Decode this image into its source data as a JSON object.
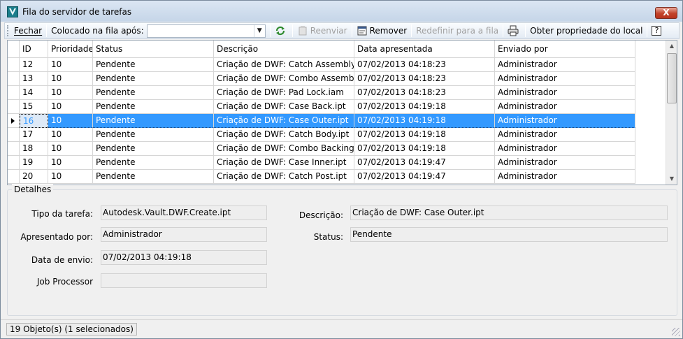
{
  "window": {
    "title": "Fila do servidor de tarefas",
    "close_label": "X"
  },
  "toolbar": {
    "close_label": "Fechar",
    "queued_after_label": "Colocado na fila após:",
    "queued_after_value": "",
    "resubmit_label": "Reenviar",
    "remove_label": "Remover",
    "reset_label": "Redefinir para a fila",
    "get_location_property_label": "Obter propriedade do local",
    "help_label": "?"
  },
  "grid": {
    "columns": [
      "ID",
      "Prioridade",
      "Status",
      "Descrição",
      "Data apresentada",
      "Enviado por"
    ],
    "rows": [
      {
        "id": "12",
        "priority": "10",
        "status": "Pendente",
        "description": "Criação de DWF: Catch Assembly.i...",
        "date": "07/02/2013 04:18:23",
        "sender": "Administrador"
      },
      {
        "id": "13",
        "priority": "10",
        "status": "Pendente",
        "description": "Criação de DWF: Combo Assembly...",
        "date": "07/02/2013 04:18:23",
        "sender": "Administrador"
      },
      {
        "id": "14",
        "priority": "10",
        "status": "Pendente",
        "description": "Criação de DWF: Pad Lock.iam",
        "date": "07/02/2013 04:18:23",
        "sender": "Administrador"
      },
      {
        "id": "15",
        "priority": "10",
        "status": "Pendente",
        "description": "Criação de DWF: Case Back.ipt",
        "date": "07/02/2013 04:19:18",
        "sender": "Administrador"
      },
      {
        "id": "16",
        "priority": "10",
        "status": "Pendente",
        "description": "Criação de DWF: Case Outer.ipt",
        "date": "07/02/2013 04:19:18",
        "sender": "Administrador"
      },
      {
        "id": "17",
        "priority": "10",
        "status": "Pendente",
        "description": "Criação de DWF: Catch Body.ipt",
        "date": "07/02/2013 04:19:18",
        "sender": "Administrador"
      },
      {
        "id": "18",
        "priority": "10",
        "status": "Pendente",
        "description": "Criação de DWF: Combo Backing P...",
        "date": "07/02/2013 04:19:18",
        "sender": "Administrador"
      },
      {
        "id": "19",
        "priority": "10",
        "status": "Pendente",
        "description": "Criação de DWF: Case Inner.ipt",
        "date": "07/02/2013 04:19:47",
        "sender": "Administrador"
      },
      {
        "id": "20",
        "priority": "10",
        "status": "Pendente",
        "description": "Criação de DWF: Catch Post.ipt",
        "date": "07/02/2013 04:19:47",
        "sender": "Administrador"
      }
    ]
  },
  "details": {
    "title": "Detalhes",
    "task_type_label": "Tipo da tarefa:",
    "task_type_value": "Autodesk.Vault.DWF.Create.ipt",
    "submitted_by_label": "Apresentado por:",
    "submitted_by_value": "Administrador",
    "send_date_label": "Data de envio:",
    "send_date_value": "07/02/2013 04:19:18",
    "job_processor_label": "Job Processor",
    "job_processor_value": "",
    "description_label": "Descrição:",
    "description_value": "Criação de DWF: Case Outer.ipt",
    "status_label": "Status:",
    "status_value": "Pendente"
  },
  "statusbar": {
    "text": "19 Objeto(s) (1 selecionados)"
  },
  "colors": {
    "selection": "#3399ff",
    "titlebar": "#c5d5e8",
    "close": "#c2432b"
  }
}
